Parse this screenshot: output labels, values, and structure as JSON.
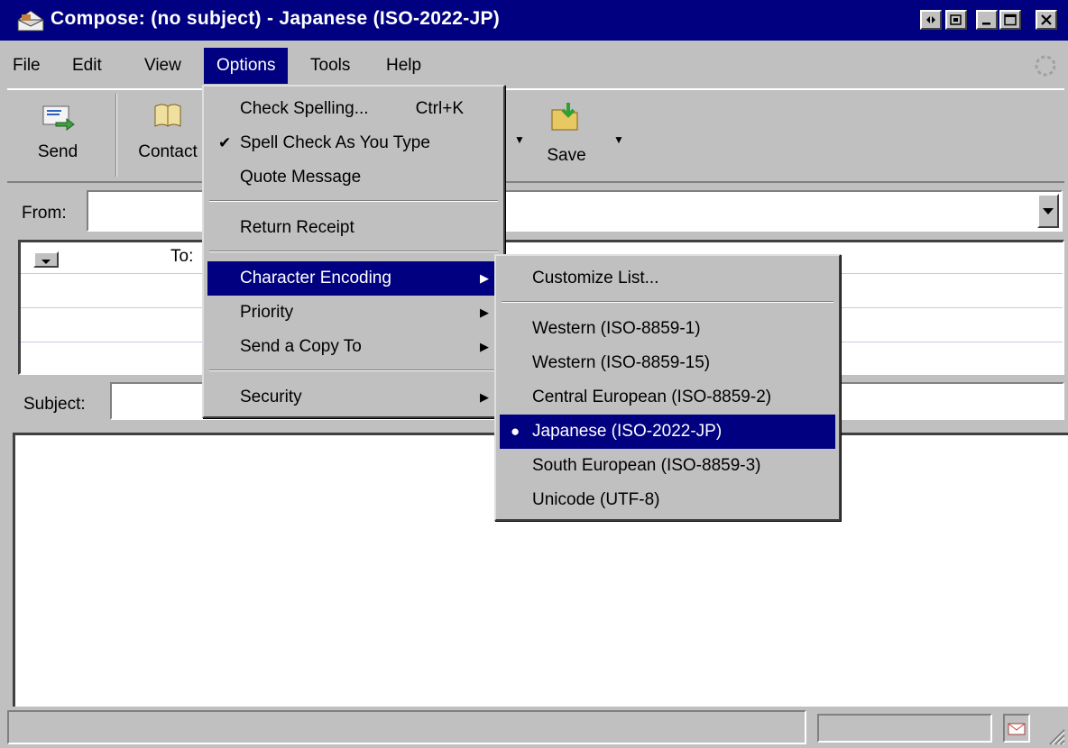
{
  "window": {
    "title": "Compose: (no subject) - Japanese (ISO-2022-JP)"
  },
  "menubar": {
    "items": [
      {
        "label": "File"
      },
      {
        "label": "Edit"
      },
      {
        "label": "View"
      },
      {
        "label": "Options"
      },
      {
        "label": "Tools"
      },
      {
        "label": "Help"
      }
    ],
    "active": "Options"
  },
  "toolbar": {
    "send_label": "Send",
    "contacts_label": "Contact",
    "save_label": "Save"
  },
  "header": {
    "from_label": "From:",
    "from_value": "",
    "to_label": "To:",
    "subject_label": "Subject:",
    "subject_value": ""
  },
  "options_menu": {
    "items": [
      {
        "label": "Check Spelling...",
        "shortcut": "Ctrl+K"
      },
      {
        "label": "Spell Check As You Type",
        "checked": true
      },
      {
        "label": "Quote Message"
      },
      {
        "label": "Return Receipt"
      },
      {
        "label": "Character Encoding",
        "submenu": true,
        "highlighted": true
      },
      {
        "label": "Priority",
        "submenu": true
      },
      {
        "label": "Send a Copy To",
        "submenu": true
      },
      {
        "label": "Security",
        "submenu": true
      }
    ]
  },
  "encoding_menu": {
    "items": [
      {
        "label": "Customize List..."
      },
      {
        "label": "Western (ISO-8859-1)"
      },
      {
        "label": "Western (ISO-8859-15)"
      },
      {
        "label": "Central European (ISO-8859-2)"
      },
      {
        "label": "Japanese (ISO-2022-JP)",
        "selected": true
      },
      {
        "label": "South European (ISO-8859-3)"
      },
      {
        "label": "Unicode (UTF-8)"
      }
    ]
  },
  "colors": {
    "title_bar": "#000080",
    "face": "#c0c0c0",
    "highlight": "#000080"
  }
}
